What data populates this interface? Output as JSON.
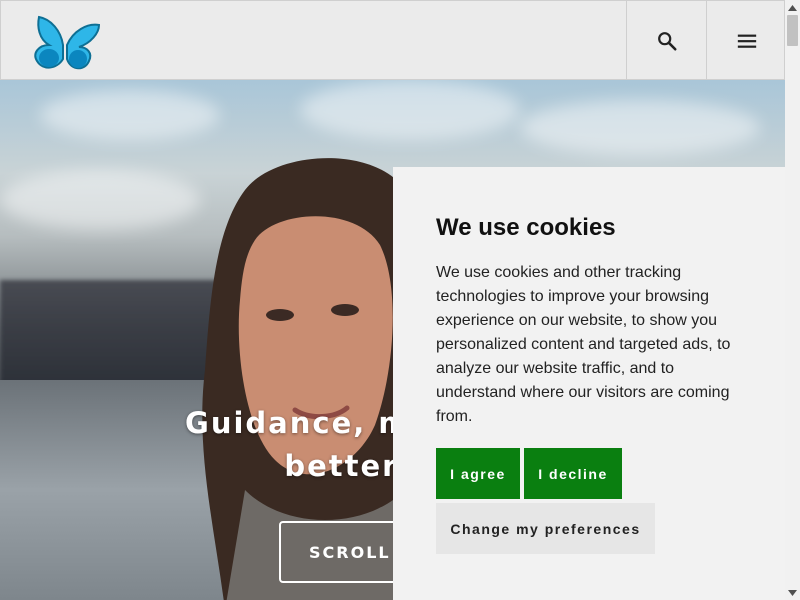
{
  "header": {
    "logo": "butterfly-logo",
    "search_icon": "search-icon",
    "menu_icon": "hamburger-menu-icon"
  },
  "hero": {
    "title_line1": "Guidance, mentoring a",
    "title_line2": "better fashi",
    "scroll_label": "SCROLL D"
  },
  "cookie_dialog": {
    "title": "We use cookies",
    "body": "We use cookies and other tracking technologies to improve your browsing experience on our website, to show you personalized content and targeted ads, to analyze our website traffic, and to understand where our visitors are coming from.",
    "agree_label": "I agree",
    "decline_label": "I decline",
    "preferences_label": "Change my preferences"
  },
  "colors": {
    "accent_green": "#0a7f10",
    "logo_blue": "#1aa3d6",
    "header_bg": "#ebebeb",
    "dialog_bg": "#f2f2f2"
  }
}
